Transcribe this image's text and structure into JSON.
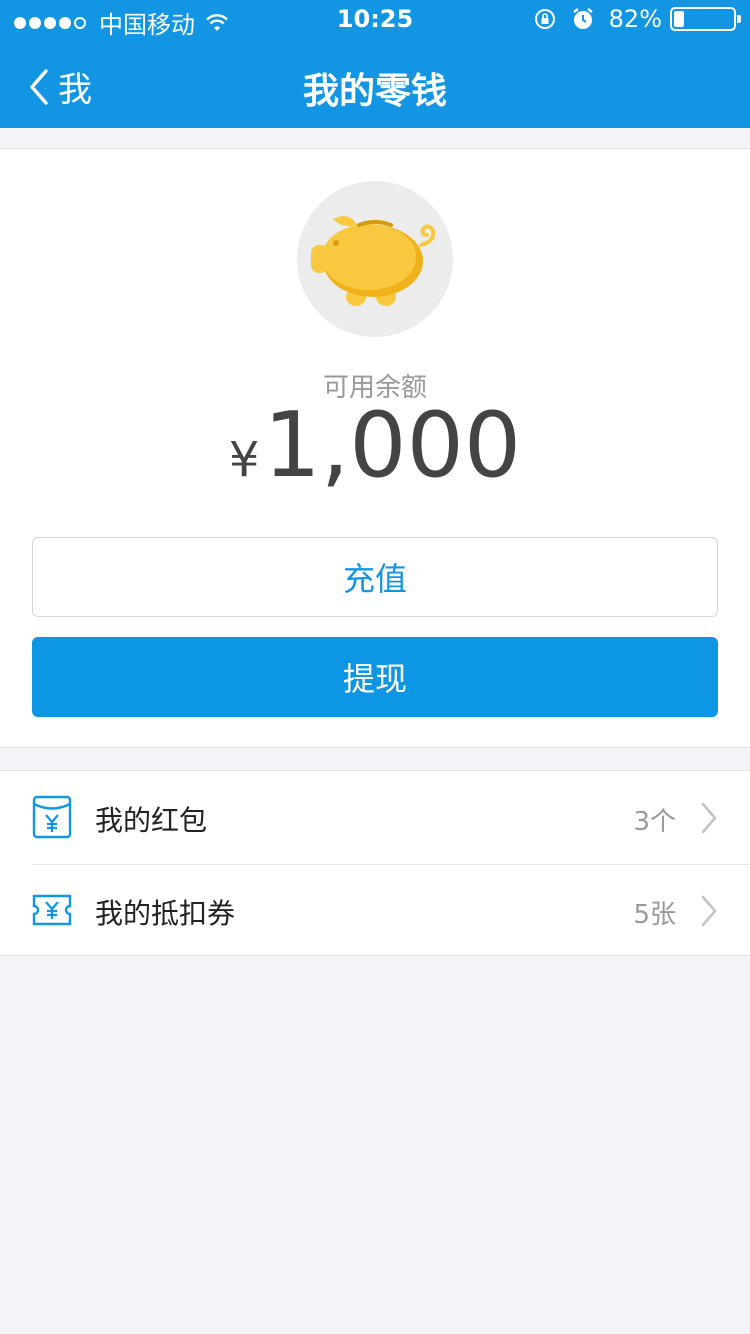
{
  "status": {
    "carrier": "中国移动",
    "time": "10:25",
    "battery_pct": "82%",
    "battery_level": 0.18
  },
  "nav": {
    "back_label": "我",
    "title": "我的零钱"
  },
  "wallet": {
    "balance_label": "可用余额",
    "currency": "¥",
    "amount": "1,000",
    "recharge_label": "充值",
    "withdraw_label": "提现"
  },
  "list": {
    "items": [
      {
        "label": "我的红包",
        "count": "3个",
        "icon": "red-packet-icon"
      },
      {
        "label": "我的抵扣券",
        "count": "5张",
        "icon": "coupon-icon"
      }
    ]
  },
  "colors": {
    "primary": "#1296e4",
    "pig": "#f8c93f",
    "pig_shade": "#f0b21a",
    "background": "#f4f4f8"
  }
}
